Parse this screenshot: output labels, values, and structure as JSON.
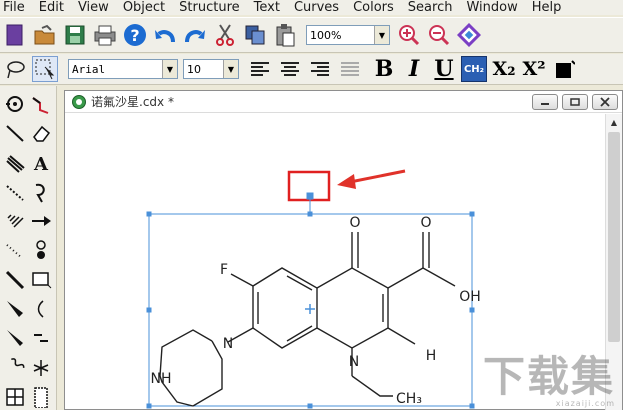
{
  "menu": [
    "File",
    "Edit",
    "View",
    "Object",
    "Structure",
    "Text",
    "Curves",
    "Colors",
    "Search",
    "Window",
    "Help"
  ],
  "toolbar": {
    "zoom": "100%",
    "font_name": "Arial",
    "font_size": "10",
    "bold": "B",
    "italic": "I",
    "underline": "U",
    "formula_btn": "CH₂",
    "subscript": "X₂",
    "superscript": "X²"
  },
  "document": {
    "title": "诺氟沙星.cdx *"
  },
  "molecule": {
    "atoms": {
      "o_ketone": "O",
      "o_acid": "O",
      "oh": "OH",
      "f": "F",
      "n_pip": "N",
      "nh": "NH",
      "n_ring": "N",
      "h": "H",
      "ch3": "CH₃"
    }
  },
  "watermark": {
    "main": "下载集",
    "sub": "xiazaiji.com"
  },
  "colors": {
    "selection": "#4a90d9",
    "highlight": "#e02020",
    "arrow": "#e0322a",
    "help_blue": "#1c6bd1"
  }
}
